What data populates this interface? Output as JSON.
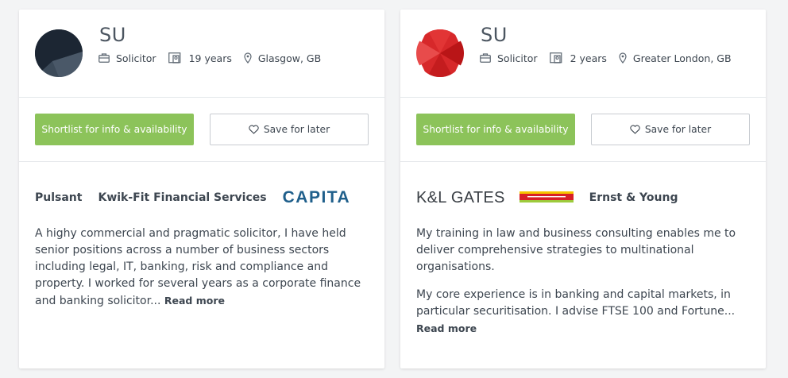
{
  "cards": [
    {
      "name": "SU",
      "role": "Solicitor",
      "experience": "19 years",
      "location": "Glasgow, GB",
      "avatar_colors": [
        "#1c2633",
        "#3c4a59"
      ],
      "shortlist_label": "Shortlist for info & availability",
      "save_label": "Save for later",
      "companies": [
        "Pulsant",
        "Kwik-Fit Financial Services",
        "CAPITA"
      ],
      "bio_paragraphs": [
        "A highy commercial and pragmatic solicitor, I have held senior positions across a number of business sectors including legal, IT, banking, risk and compliance and property. I worked for several years as a corporate finance and banking solicitor..."
      ],
      "read_more": "Read more"
    },
    {
      "name": "SU",
      "role": "Solicitor",
      "experience": "2 years",
      "location": "Greater London, GB",
      "avatar_colors": [
        "#c8191c",
        "#e63a3a"
      ],
      "shortlist_label": "Shortlist for info & availability",
      "save_label": "Save for later",
      "companies": [
        "K&L GATES",
        "Ernst & Young"
      ],
      "bio_paragraphs": [
        "My training in law and business consulting enables me to deliver comprehensive strategies to multinational organisations.",
        "My core experience is in banking and capital markets, in particular securitisation. I advise FTSE 100 and Fortune..."
      ],
      "read_more": "Read more"
    }
  ],
  "colors": {
    "shortlist_green": "#8cc35a",
    "capita_blue": "#1f5f8b",
    "page_bg": "#f3f4f5"
  }
}
